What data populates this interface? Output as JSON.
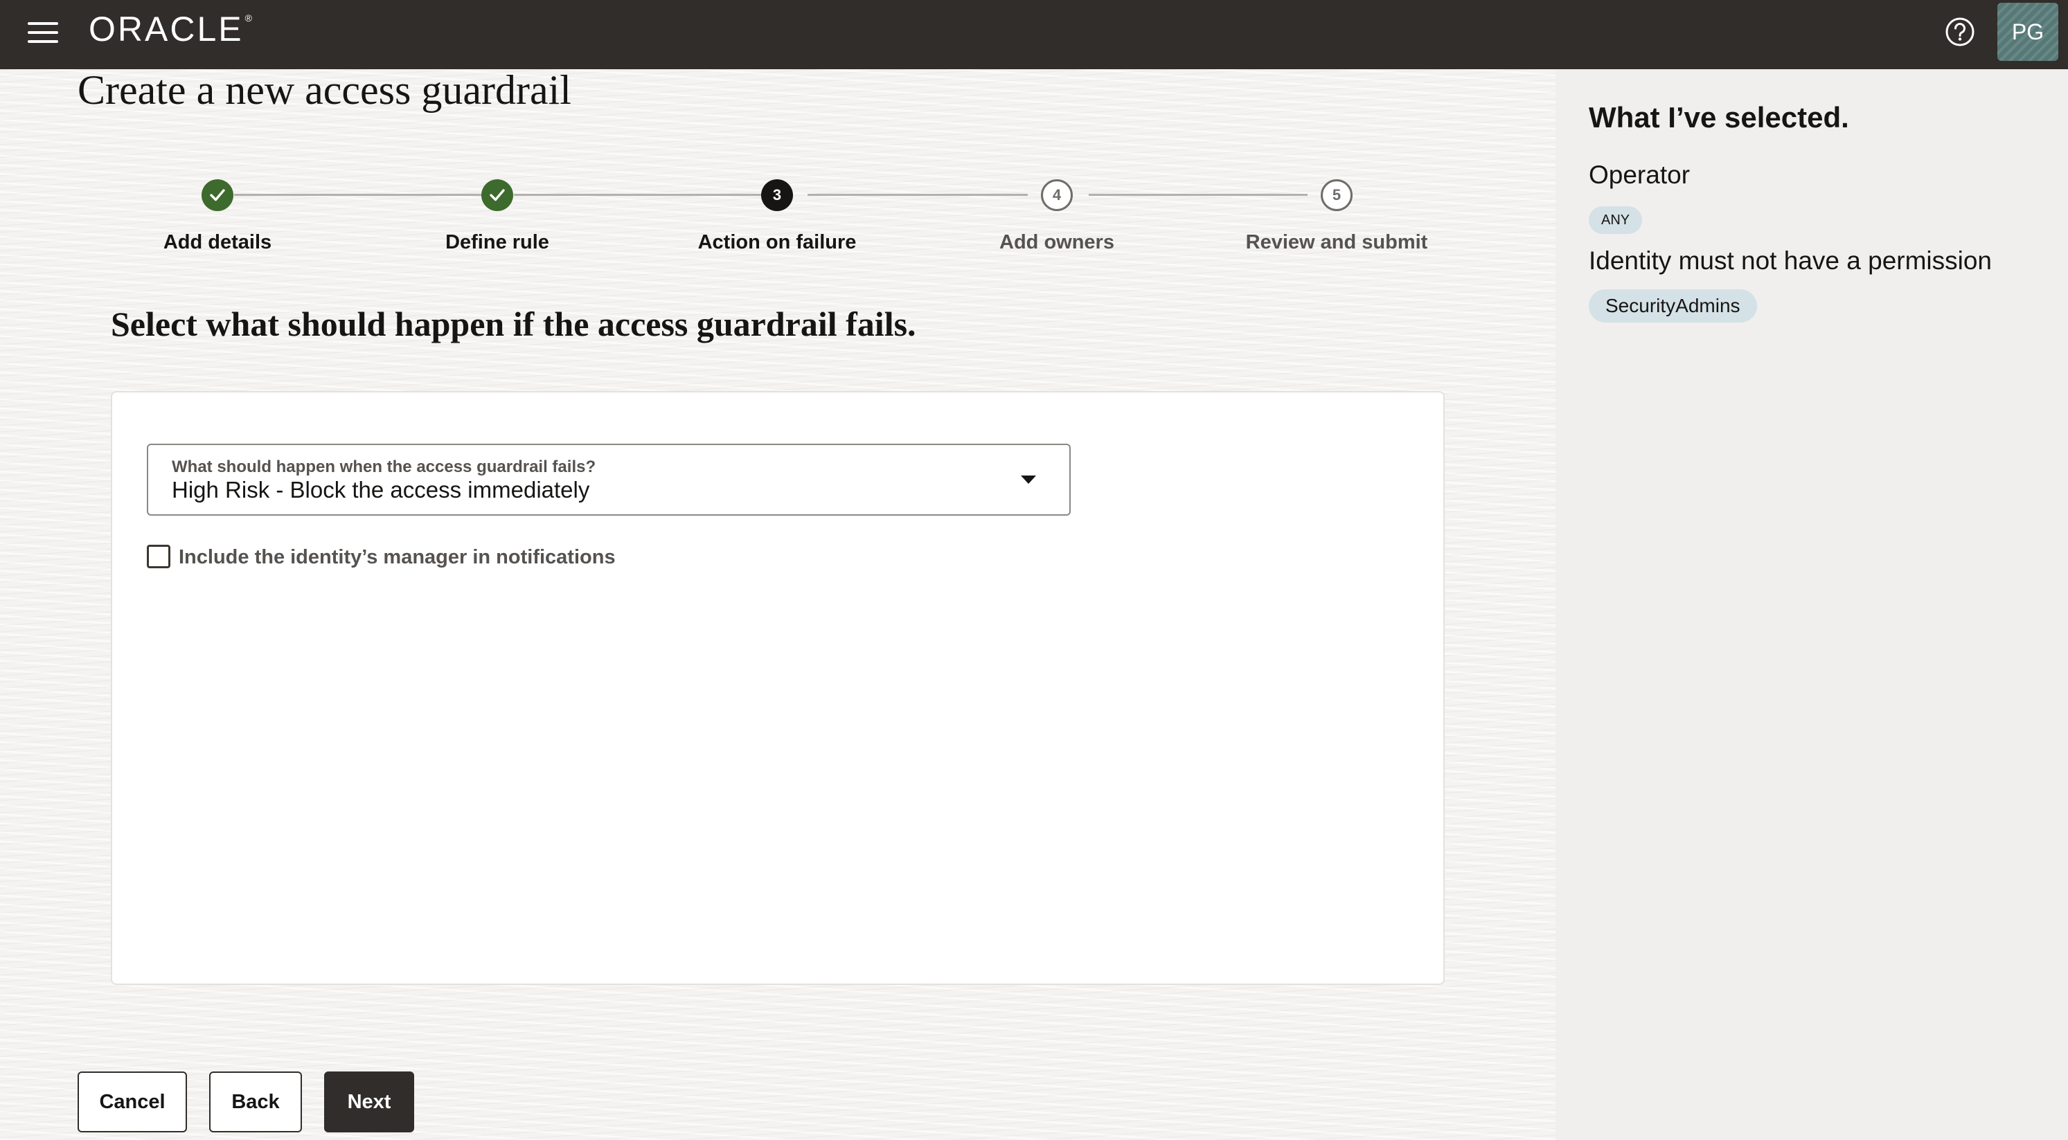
{
  "header": {
    "brand": "ORACLE",
    "avatar_initials": "PG",
    "icons": [
      "hamburger-menu-icon",
      "help-icon"
    ]
  },
  "page": {
    "title": "Create a new access guardrail"
  },
  "stepper": {
    "current_step": 3,
    "steps": [
      {
        "number": "1",
        "label": "Add details",
        "state": "done"
      },
      {
        "number": "2",
        "label": "Define rule",
        "state": "done"
      },
      {
        "number": "3",
        "label": "Action on failure",
        "state": "current"
      },
      {
        "number": "4",
        "label": "Add owners",
        "state": "todo"
      },
      {
        "number": "5",
        "label": "Review and submit",
        "state": "todo"
      }
    ]
  },
  "section": {
    "title": "Select what should happen if the access guardrail fails."
  },
  "form": {
    "select_label": "What should happen when the access guardrail fails?",
    "select_value": "High Risk - Block the access immediately",
    "checkbox_label": "Include the identity’s manager in notifications",
    "checkbox_checked": false
  },
  "footer": {
    "cancel_label": "Cancel",
    "back_label": "Back",
    "next_label": "Next"
  },
  "summary": {
    "title": "What I’ve selected.",
    "operator_heading": "Operator",
    "operator_value": "ANY",
    "permission_heading": "Identity must not have a permission",
    "permission_value": "SecurityAdmins"
  },
  "colors": {
    "header_bg": "#312d2a",
    "step_done": "#3d6a2d",
    "step_current": "#161513",
    "chip_bg": "#d4e1e6",
    "primary_button": "#312d2a"
  }
}
